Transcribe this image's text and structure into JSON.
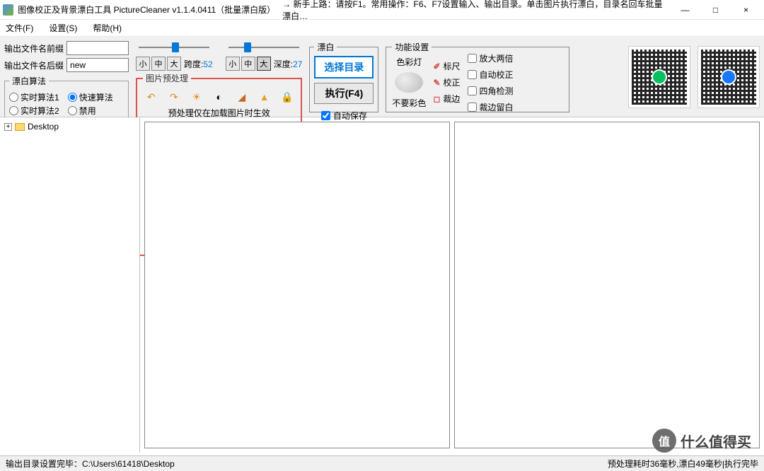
{
  "window": {
    "title": "图像校正及背景漂白工具 PictureCleaner v1.1.4.0411（批量漂白版）",
    "hint": "→ 新手上路：请按F1。常用操作：F6、F7设置输入、输出目录。单击图片执行漂白，目录名回车批量漂白…",
    "min": "—",
    "max": "□",
    "close": "×"
  },
  "menu": {
    "file": "文件(F)",
    "settings": "设置(S)",
    "help": "帮助(H)"
  },
  "output": {
    "prefix_label": "输出文件名前缀",
    "prefix_value": "",
    "suffix_label": "输出文件名后缀",
    "suffix_value": "new"
  },
  "algo": {
    "legend": "漂白算法",
    "rt1": "实时算法1",
    "fast": "快速算法",
    "rt2": "实时算法2",
    "disable": "禁用"
  },
  "sliders": {
    "small": "小",
    "mid": "中",
    "large": "大",
    "span_label": "跨度:",
    "span_value": "52",
    "depth_label": "深度:",
    "depth_value": "27"
  },
  "preproc": {
    "legend": "图片预处理",
    "hint": "预处理仅在加载图片时生效"
  },
  "bleach": {
    "legend": "漂白",
    "select_dir": "选择目录",
    "exec": "执行(F4)",
    "autosave": "自动保存"
  },
  "func": {
    "legend": "功能设置",
    "color_label": "色彩灯",
    "no_color": "不要彩色",
    "ruler": "标尺",
    "correct": "校正",
    "crop": "裁边",
    "zoom2x": "放大两倍",
    "auto_correct": "自动校正",
    "corner_detect": "四角检测",
    "crop_blank": "裁边留白"
  },
  "tree": {
    "root": "Desktop"
  },
  "status": {
    "left": "输出目录设置完毕：C:\\Users\\61418\\Desktop",
    "right": "预处理耗时36毫秒,漂白49毫秒|执行完毕"
  },
  "watermark": {
    "circle": "值",
    "text": "什么值得买"
  }
}
